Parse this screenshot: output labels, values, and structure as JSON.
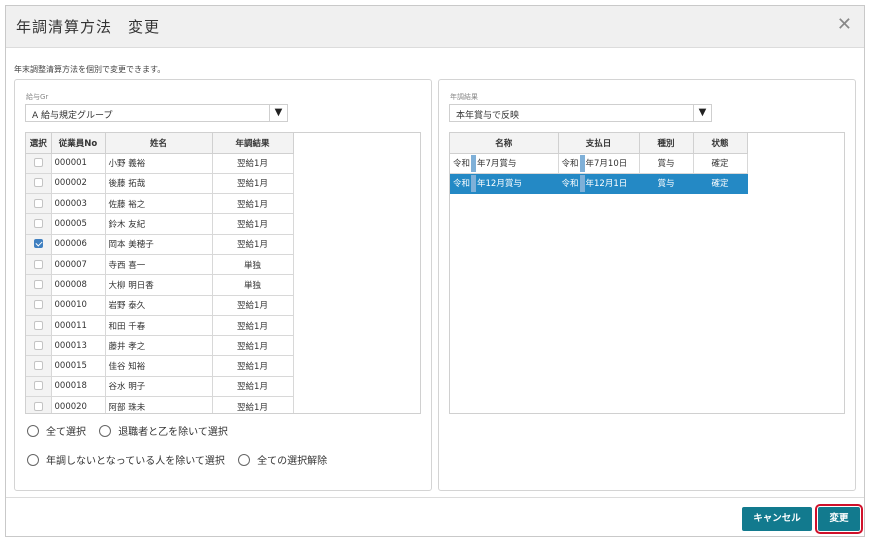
{
  "dialog": {
    "title": "年調清算方法　変更",
    "close_glyph": "✕",
    "description": "年末調整清算方法を個別で変更できます。"
  },
  "left_panel": {
    "group_label": "給与Gr",
    "group_value": "A 給与規定グループ",
    "dropdown_arrow": "▼",
    "columns": [
      "選択",
      "従業員No",
      "姓名",
      "年調結果"
    ],
    "rows": [
      {
        "checked": false,
        "no": "000001",
        "name": "小野 義裕",
        "result": "翌給1月"
      },
      {
        "checked": false,
        "no": "000002",
        "name": "後藤 拓哉",
        "result": "翌給1月"
      },
      {
        "checked": false,
        "no": "000003",
        "name": "佐藤 裕之",
        "result": "翌給1月"
      },
      {
        "checked": false,
        "no": "000005",
        "name": "鈴木 友紀",
        "result": "翌給1月"
      },
      {
        "checked": true,
        "no": "000006",
        "name": "岡本 美穂子",
        "result": "翌給1月"
      },
      {
        "checked": false,
        "no": "000007",
        "name": "寺西 喜一",
        "result": "単独"
      },
      {
        "checked": false,
        "no": "000008",
        "name": "大柳 明日香",
        "result": "単独"
      },
      {
        "checked": false,
        "no": "000010",
        "name": "岩野 泰久",
        "result": "翌給1月"
      },
      {
        "checked": false,
        "no": "000011",
        "name": "和田 千春",
        "result": "翌給1月"
      },
      {
        "checked": false,
        "no": "000013",
        "name": "藤井 孝之",
        "result": "翌給1月"
      },
      {
        "checked": false,
        "no": "000015",
        "name": "佳谷 知裕",
        "result": "翌給1月"
      },
      {
        "checked": false,
        "no": "000018",
        "name": "谷水 明子",
        "result": "翌給1月"
      },
      {
        "checked": false,
        "no": "000020",
        "name": "阿部 珠未",
        "result": "翌給1月"
      }
    ],
    "radio_options": [
      "全て選択",
      "退職者と乙を除いて選択",
      "年調しないとなっている人を除いて選択",
      "全ての選択解除"
    ]
  },
  "right_panel": {
    "result_label": "年調結果",
    "result_value": "本年賞与で反映",
    "dropdown_arrow": "▼",
    "columns": [
      "名称",
      "支払日",
      "種別",
      "状態"
    ],
    "rows": [
      {
        "name_a": "令和",
        "name_b": "年7月賞与",
        "date_a": "令和",
        "date_b": "年7月10日",
        "type": "賞与",
        "status": "確定",
        "selected": false
      },
      {
        "name_a": "令和",
        "name_b": "年12月賞与",
        "date_a": "令和",
        "date_b": "年12月1日",
        "type": "賞与",
        "status": "確定",
        "selected": true
      }
    ]
  },
  "buttons": {
    "cancel": "キャンセル",
    "change": "変更"
  },
  "colors": {
    "accent": "#127a8e",
    "selection": "#2489c5",
    "highlight_outline": "#d0102a"
  }
}
